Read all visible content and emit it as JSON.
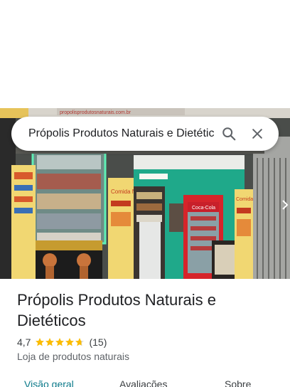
{
  "search": {
    "query": "Própolis Produtos Naturais e Dietéticos"
  },
  "place": {
    "name": "Própolis Produtos Naturais e Dietéticos",
    "rating": "4,7",
    "star_count": 4.7,
    "reviews": "(15)",
    "category": "Loja de produtos naturais"
  },
  "tabs": [
    {
      "label": "Visão geral",
      "active": true
    },
    {
      "label": "Avaliações",
      "active": false
    },
    {
      "label": "Sobre",
      "active": false
    }
  ],
  "photo": {
    "storefront_sign": "propolisprodutosnaturais.com.br",
    "side_sign_left": "Comida Natural",
    "side_sign_right": "Comida Natural",
    "fridge_brand": "Coca-Cola"
  },
  "colors": {
    "accent": "#0b7a8a",
    "star": "#fbbc04",
    "storefront_green": "#1fa98a"
  },
  "icons": {
    "search": "search-icon",
    "close": "close-icon"
  }
}
